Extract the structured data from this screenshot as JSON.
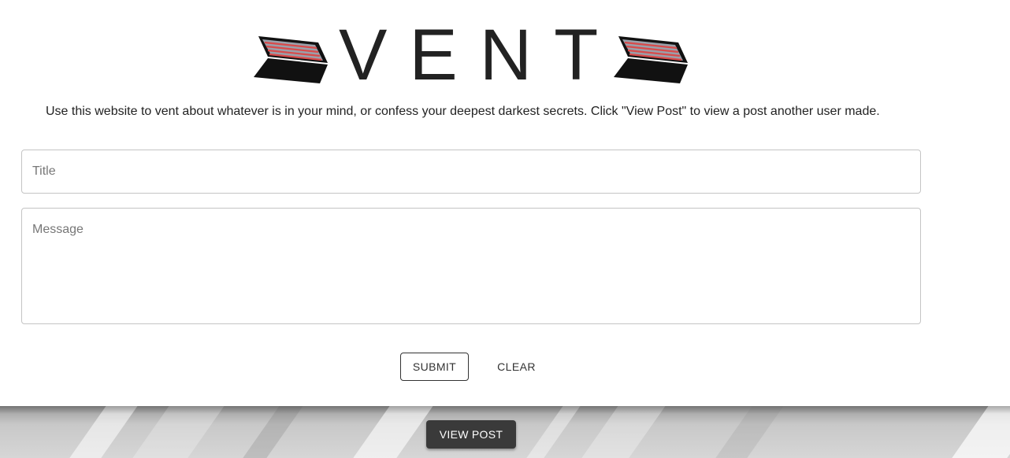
{
  "header": {
    "title": "VENT",
    "logo_icon": "open-laptop-icon"
  },
  "description": "Use this website to vent about whatever is in your mind, or confess your deepest darkest secrets. Click \"View Post\" to view a post another user made.",
  "form": {
    "title_placeholder": "Title",
    "title_value": "",
    "message_placeholder": "Message",
    "message_value": "",
    "submit_label": "Submit",
    "clear_label": "Clear"
  },
  "footer": {
    "view_post_label": "View Post"
  },
  "colors": {
    "text": "#222222",
    "button_dark": "#3a3a3a",
    "input_border": "#c4c4c4",
    "laptop_screen_red": "#d94a4a"
  }
}
